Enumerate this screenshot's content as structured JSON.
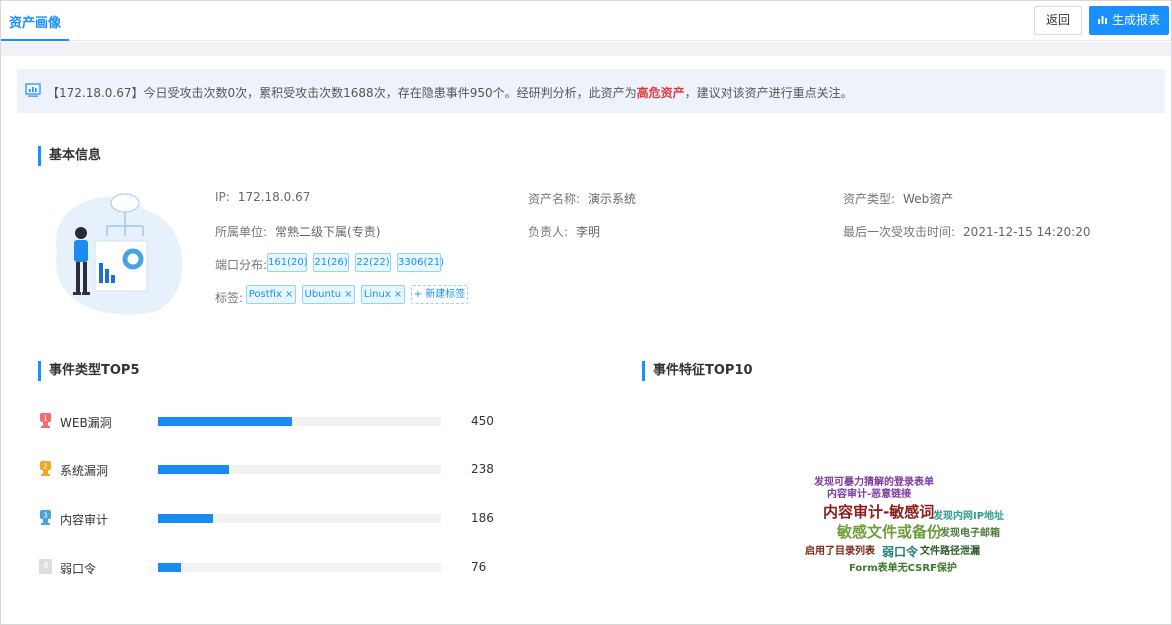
{
  "header": {
    "tab_title": "资产画像",
    "back_label": "返回",
    "report_label": "生成报表"
  },
  "alert": {
    "prefix": "【172.18.0.67】今日受攻击次数0次，累积受攻击次数1688次，存在隐患事件950个。经研判分析，此资产为",
    "risk_text": "高危资产",
    "suffix": "，建议对该资产进行重点关注。"
  },
  "basic": {
    "title": "基本信息",
    "ip_label": "IP:",
    "ip_value": "172.18.0.67",
    "asset_name_label": "资产名称:",
    "asset_name_value": "演示系统",
    "asset_type_label": "资产类型:",
    "asset_type_value": "Web资产",
    "unit_label": "所属单位:",
    "unit_value": "常熟二级下属(专责)",
    "owner_label": "负责人:",
    "owner_value": "李明",
    "last_attack_label": "最后一次受攻击时间:",
    "last_attack_value": "2021-12-15 14:20:20",
    "ports_label": "端口分布:",
    "ports": [
      "161(20)",
      "21(26)",
      "22(22)",
      "3306(21)"
    ],
    "tags_label": "标签:",
    "tags": [
      "Postfix",
      "Ubuntu",
      "Linux"
    ],
    "new_tag_label": "+ 新建标签"
  },
  "top5": {
    "title": "事件类型TOP5",
    "max": 450,
    "items": [
      {
        "rank": "1",
        "label": "WEB漏洞",
        "value": 450,
        "rank_color": "#f56c6c"
      },
      {
        "rank": "2",
        "label": "系统漏洞",
        "value": 238,
        "rank_color": "#f5a623"
      },
      {
        "rank": "3",
        "label": "内容审计",
        "value": 186,
        "rank_color": "#4aa3df"
      },
      {
        "rank": "4",
        "label": "弱口令",
        "value": 76,
        "rank_color": "#dddddd"
      }
    ]
  },
  "top10": {
    "title": "事件特征TOP10",
    "words": [
      {
        "text": "发现可暴力猜解的登录表单",
        "color": "#7b3aa0"
      },
      {
        "text": "内容审计-恶意链接",
        "color": "#7b3aa0"
      },
      {
        "text": "内容审计-敏感词",
        "color": "#8a1c1c"
      },
      {
        "text": "发现内网IP地址",
        "color": "#2e9d8f"
      },
      {
        "text": "敏感文件或备份",
        "color": "#6e9e3a"
      },
      {
        "text": "发现电子邮箱",
        "color": "#4d7a3a"
      },
      {
        "text": "启用了目录列表",
        "color": "#7a2a1a"
      },
      {
        "text": "弱口令",
        "color": "#1b7f7a"
      },
      {
        "text": "文件路径泄漏",
        "color": "#2b5a2b"
      },
      {
        "text": "Form表单无CSRF保护",
        "color": "#3a7a2a"
      }
    ]
  },
  "colors": {
    "accent": "#1890ff",
    "risk": "#e4393c"
  }
}
